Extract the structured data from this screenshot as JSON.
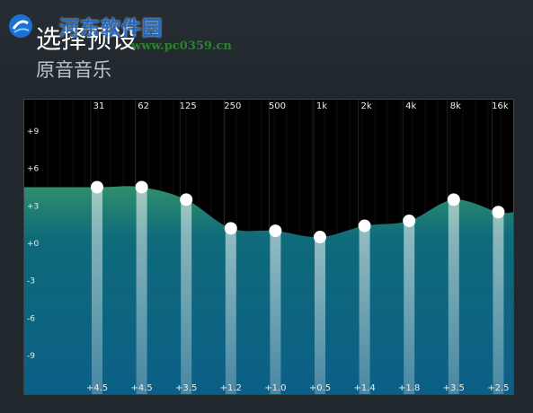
{
  "header": {
    "title": "选择预设",
    "subtitle": "原音音乐",
    "watermark": "河东软件园",
    "watermark_url": "www.pc0359.cn"
  },
  "equalizer": {
    "y_ticks": [
      "+9",
      "+6",
      "+3",
      "+0",
      "-3",
      "-6",
      "-9"
    ],
    "y_values": [
      9,
      6,
      3,
      0,
      -3,
      -6,
      -9
    ],
    "bands": [
      {
        "freq": "31",
        "gain": 4.5,
        "gain_label": "+4.5"
      },
      {
        "freq": "62",
        "gain": 4.5,
        "gain_label": "+4.5"
      },
      {
        "freq": "125",
        "gain": 3.5,
        "gain_label": "+3.5"
      },
      {
        "freq": "250",
        "gain": 1.2,
        "gain_label": "+1.2"
      },
      {
        "freq": "500",
        "gain": 1.0,
        "gain_label": "+1.0"
      },
      {
        "freq": "1k",
        "gain": 0.5,
        "gain_label": "+0.5"
      },
      {
        "freq": "2k",
        "gain": 1.4,
        "gain_label": "+1.4"
      },
      {
        "freq": "4k",
        "gain": 1.8,
        "gain_label": "+1.8"
      },
      {
        "freq": "8k",
        "gain": 3.5,
        "gain_label": "+3.5"
      },
      {
        "freq": "16k",
        "gain": 2.5,
        "gain_label": "+2.5"
      }
    ],
    "colors": {
      "curve_top": "#2f8f6c",
      "curve_bottom": "#0b5f86",
      "slider": "#ffffff",
      "knob": "#ffffff"
    }
  }
}
